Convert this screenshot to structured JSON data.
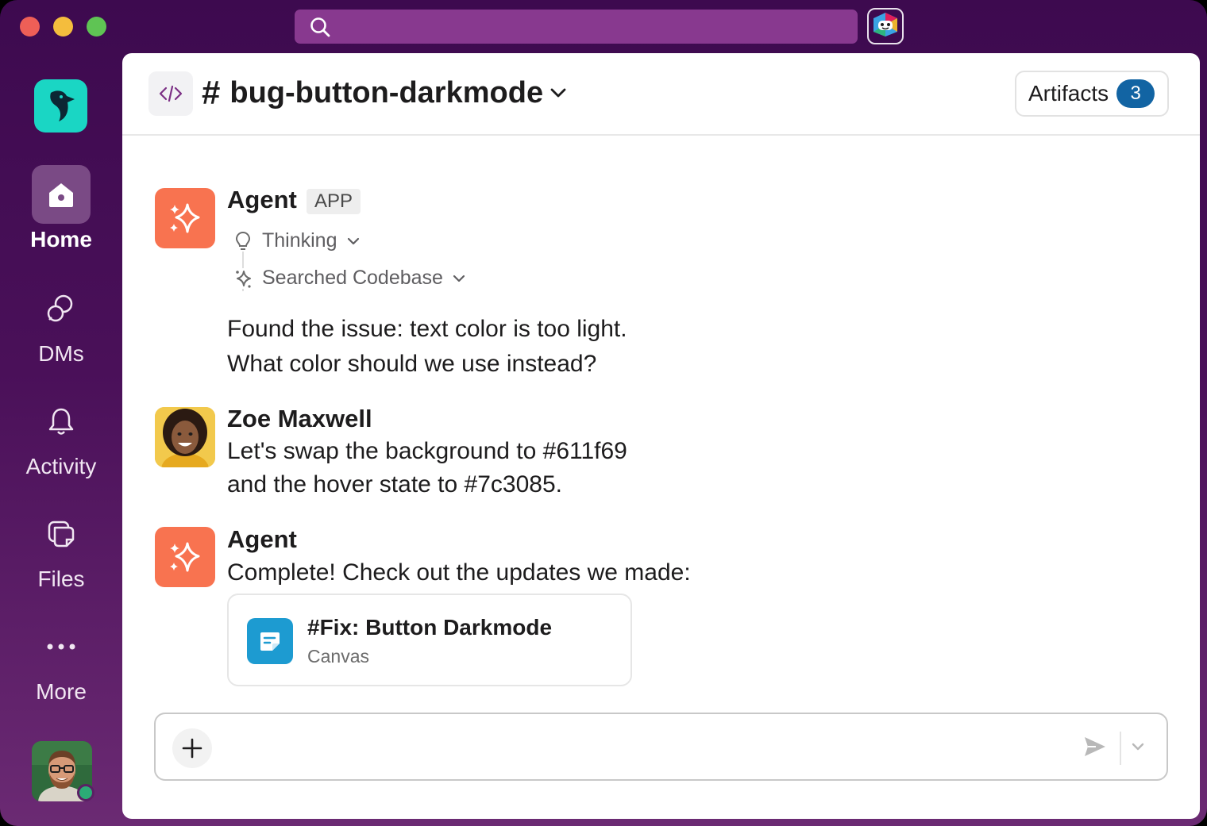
{
  "sidebar": {
    "items": [
      {
        "label": "Home",
        "icon": "home-icon",
        "active": true
      },
      {
        "label": "DMs",
        "icon": "dms-icon",
        "active": false
      },
      {
        "label": "Activity",
        "icon": "bell-icon",
        "active": false
      },
      {
        "label": "Files",
        "icon": "files-icon",
        "active": false
      },
      {
        "label": "More",
        "icon": "more-icon",
        "active": false
      }
    ]
  },
  "header": {
    "channel_name": "bug-button-darkmode",
    "hash": "#",
    "artifacts_label": "Artifacts",
    "artifacts_count": "3"
  },
  "messages": [
    {
      "sender": "Agent",
      "tag": "APP",
      "steps": [
        {
          "label": "Thinking",
          "icon": "lightbulb-icon"
        },
        {
          "label": "Searched Codebase",
          "icon": "sparkle-icon"
        }
      ],
      "lines": [
        "Found the issue: text color is too light.",
        "What color should we use instead?"
      ]
    },
    {
      "sender": "Zoe Maxwell",
      "lines": [
        "Let's swap the background to #611f69",
        "and the hover state to #7c3085."
      ]
    },
    {
      "sender": "Agent",
      "lines": [
        "Complete! Check out the updates we made:"
      ],
      "attachment": {
        "title": "#Fix: Button Darkmode",
        "type": "Canvas"
      }
    }
  ],
  "composer": {
    "value": "",
    "placeholder": ""
  },
  "colors": {
    "sidebar_top": "#3d0a4f",
    "search": "#88398f",
    "agent_avatar": "#f87350",
    "badge": "#1264a3",
    "canvas_icon": "#1d9bd1",
    "workspace_logo": "#1ad6c4"
  }
}
